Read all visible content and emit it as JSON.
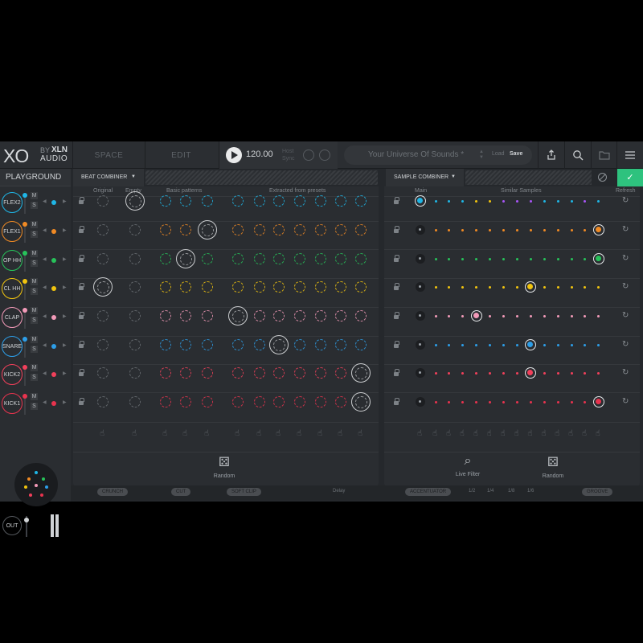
{
  "header": {
    "logo": {
      "xo": "XO",
      "by": "BY",
      "xln": "XLN",
      "audio": "AUDIO"
    },
    "tabs": [
      "SPACE",
      "EDIT"
    ],
    "bpm": "120.00",
    "host_sync": "Host Sync",
    "preset_name": "Your Universe Of Sounds *",
    "load_label": "Load",
    "save_label": "Save",
    "icons": [
      "share-icon",
      "search-icon",
      "folder-icon",
      "menu-icon"
    ]
  },
  "bar2": {
    "playground": "PLAYGROUND",
    "beat_combiner": "BEAT COMBINER",
    "sample_combiner": "SAMPLE COMBINER"
  },
  "tracks": [
    {
      "name": "FLEX2",
      "color": "#1fb6e6"
    },
    {
      "name": "FLEX1",
      "color": "#f08a24"
    },
    {
      "name": "OP HH",
      "color": "#27c25a"
    },
    {
      "name": "CL HH",
      "color": "#f1c40f"
    },
    {
      "name": "CLAP",
      "color": "#f29ab8"
    },
    {
      "name": "SNARE",
      "color": "#2d9ee8"
    },
    {
      "name": "KICK2",
      "color": "#f2405b"
    },
    {
      "name": "KICK1",
      "color": "#e8334e"
    }
  ],
  "mute_label": "M",
  "solo_label": "S",
  "out_label": "OUT",
  "beat_combiner": {
    "headers": {
      "original": "Original",
      "empty": "Empty",
      "basic": "Basic patterns",
      "extracted": "Extracted from presets"
    },
    "random_label": "Random"
  },
  "sample_combiner": {
    "headers": {
      "main": "Main",
      "similar": "Similar Samples",
      "refresh": "Refresh"
    },
    "live_filter_label": "Live Filter",
    "random_label": "Random"
  },
  "bottom": {
    "crunch": "CRUNCH",
    "cut": "CUT",
    "soft_clip": "SOFT CLIP",
    "delay": "Delay",
    "accentuator": "ACCENTUATOR",
    "divs": [
      "1/2",
      "1/4",
      "1/8",
      "1/6"
    ],
    "groove": "GROOVE"
  }
}
